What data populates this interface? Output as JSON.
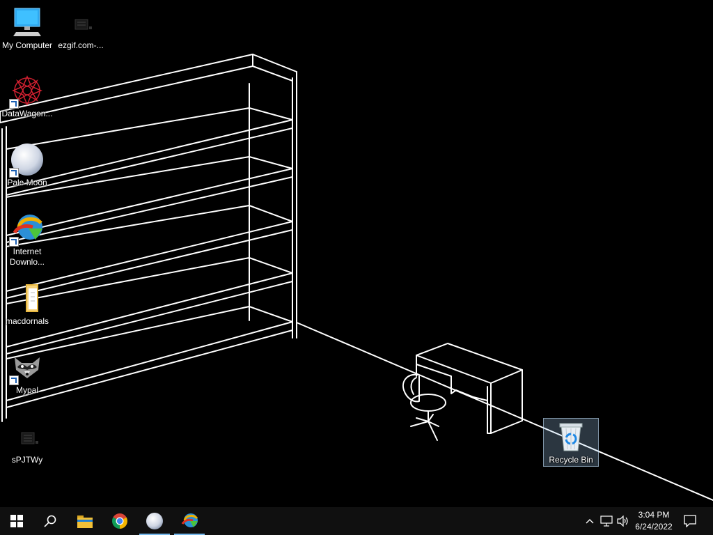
{
  "desktop": {
    "icons": [
      {
        "id": "my-computer",
        "label": "My Computer",
        "icon": "computer-icon",
        "shortcut": false
      },
      {
        "id": "ezgif",
        "label": "ezgif.com-...",
        "icon": "app-window-icon",
        "shortcut": false
      },
      {
        "id": "datawagon",
        "label": "DataWagon...",
        "icon": "datawagon-icon",
        "shortcut": true
      },
      {
        "id": "pale-moon",
        "label": "Pale Moon",
        "icon": "pale-moon-icon",
        "shortcut": true
      },
      {
        "id": "idm",
        "label": "Internet Downlo...",
        "label_line1": "Internet",
        "label_line2": "Downlo...",
        "icon": "internet-download-manager-icon",
        "shortcut": true
      },
      {
        "id": "macdornals",
        "label": "macdornals",
        "icon": "folder-icon",
        "shortcut": false
      },
      {
        "id": "mypal",
        "label": "Mypal",
        "icon": "raccoon-icon",
        "shortcut": true
      },
      {
        "id": "spjtwy",
        "label": "sPJTWy",
        "icon": "app-window-icon",
        "shortcut": false
      },
      {
        "id": "recycle-bin",
        "label": "Recycle Bin",
        "icon": "recycle-bin-icon",
        "shortcut": false,
        "selected": true
      }
    ]
  },
  "taskbar": {
    "start": "windows-start-icon",
    "search": "search-icon",
    "pinned": [
      {
        "name": "file-explorer",
        "icon": "folder-icon",
        "active": false
      },
      {
        "name": "chrome",
        "icon": "chrome-icon",
        "active": false
      },
      {
        "name": "pale-moon",
        "icon": "pale-moon-icon",
        "active": true
      },
      {
        "name": "internet-download-manager",
        "icon": "internet-download-manager-icon",
        "active": true
      }
    ],
    "tray": {
      "chevron": "chevron-up-icon",
      "network": "network-icon",
      "volume": "volume-icon",
      "notifications": "notification-icon"
    },
    "clock": {
      "time": "3:04 PM",
      "date": "6/24/2022"
    }
  },
  "colors": {
    "desktop_bg": "#000000",
    "taskbar_bg": "#101010",
    "active_indicator": "#76b9ed",
    "selection": "#add8ff"
  }
}
